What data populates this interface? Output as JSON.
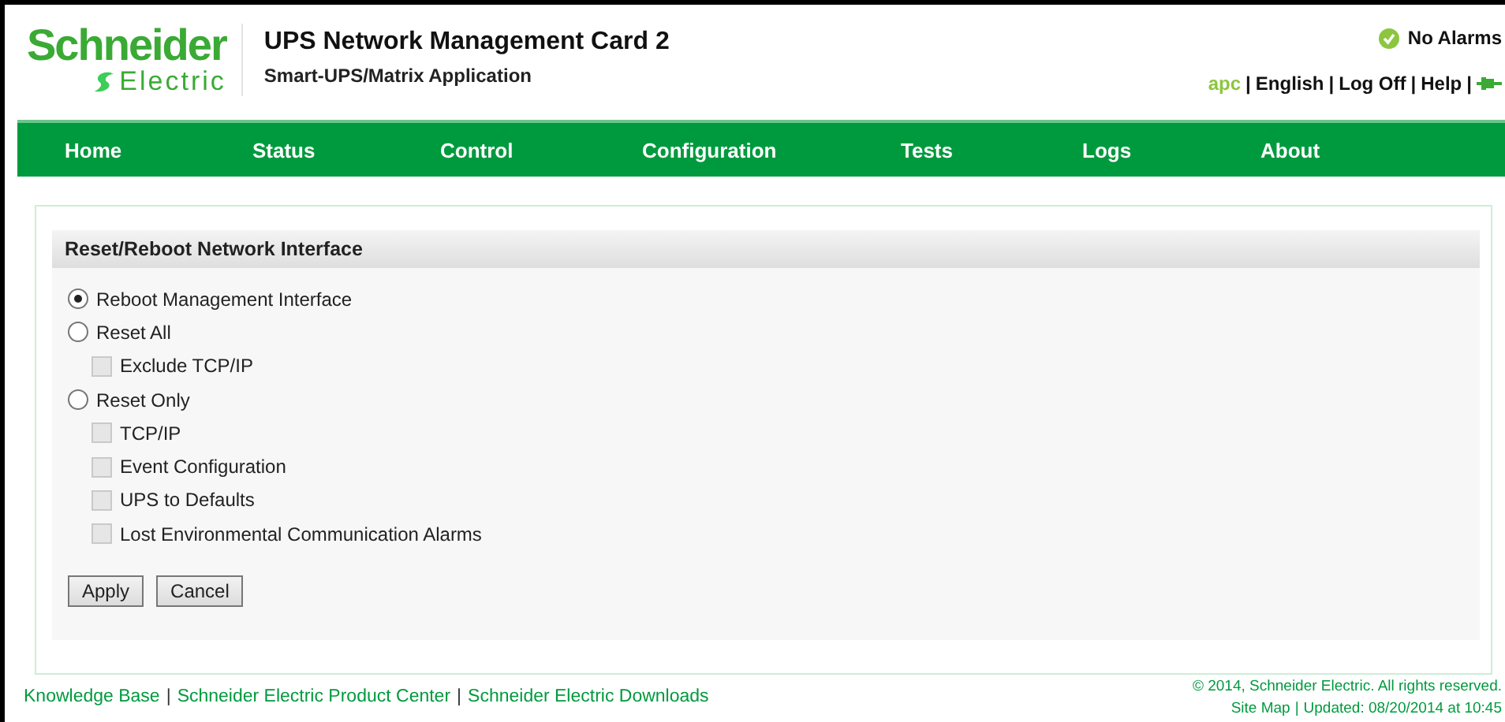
{
  "logo": {
    "line1": "Schneider",
    "line2": "Electric"
  },
  "header": {
    "title": "UPS Network Management Card 2",
    "subtitle": "Smart-UPS/Matrix Application"
  },
  "alarm_status": {
    "text": "No Alarms"
  },
  "user_menu": {
    "user": "apc",
    "separator": "|",
    "links": [
      "English",
      "Log Off",
      "Help"
    ]
  },
  "nav": [
    {
      "label": "Home",
      "selected": false
    },
    {
      "label": "Status",
      "selected": false
    },
    {
      "label": "Control",
      "selected": false
    },
    {
      "label": "Configuration",
      "selected": false
    },
    {
      "label": "Tests",
      "selected": false
    },
    {
      "label": "Logs",
      "selected": false
    },
    {
      "label": "About",
      "selected": false
    }
  ],
  "panel": {
    "title": "Reset/Reboot Network Interface",
    "options": [
      {
        "kind": "radio",
        "label": "Reboot Management Interface",
        "checked": true,
        "disabled": false
      },
      {
        "kind": "radio",
        "label": "Reset All",
        "checked": false,
        "disabled": false,
        "children": [
          {
            "kind": "checkbox",
            "label": "Exclude TCP/IP",
            "checked": false,
            "disabled": true
          }
        ]
      },
      {
        "kind": "radio",
        "label": "Reset Only",
        "checked": false,
        "disabled": false,
        "children": [
          {
            "kind": "checkbox",
            "label": "TCP/IP",
            "checked": false,
            "disabled": true
          },
          {
            "kind": "checkbox",
            "label": "Event Configuration",
            "checked": false,
            "disabled": true
          },
          {
            "kind": "checkbox",
            "label": "UPS to Defaults",
            "checked": false,
            "disabled": true
          },
          {
            "kind": "checkbox",
            "label": "Lost Environmental Communication Alarms",
            "checked": false,
            "disabled": true
          }
        ]
      }
    ],
    "buttons": [
      "Apply",
      "Cancel"
    ]
  },
  "footer": {
    "separator": "|",
    "links": [
      "Knowledge Base",
      "Schneider Electric Product Center",
      "Schneider Electric Downloads"
    ],
    "copyright": "© 2014, Schneider Electric. All rights reserved.",
    "site_map": "Site Map",
    "updated": "Updated: 08/20/2014 at 10:45"
  }
}
